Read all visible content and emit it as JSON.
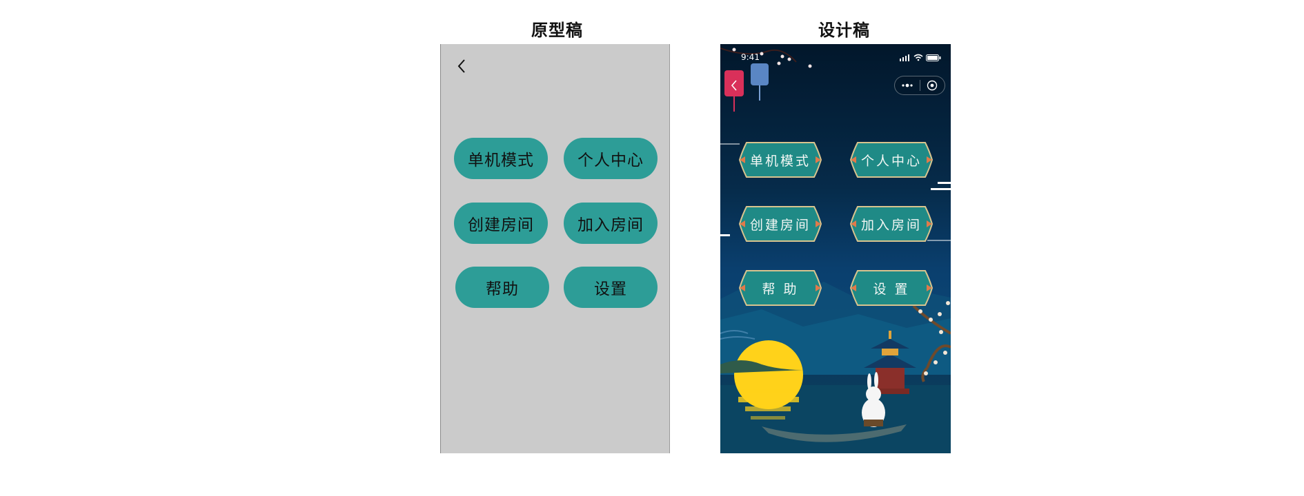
{
  "headings": {
    "prototype": "原型稿",
    "design": "设计稿"
  },
  "menu": [
    {
      "id": "single",
      "label": "单机模式",
      "design_label": "单机模式"
    },
    {
      "id": "profile",
      "label": "个人中心",
      "design_label": "个人中心"
    },
    {
      "id": "create",
      "label": "创建房间",
      "design_label": "创建房间"
    },
    {
      "id": "join",
      "label": "加入房间",
      "design_label": "加入房间"
    },
    {
      "id": "help",
      "label": "帮助",
      "design_label": "帮 助"
    },
    {
      "id": "settings",
      "label": "设置",
      "design_label": "设 置"
    }
  ],
  "statusbar": {
    "time": "9:41"
  },
  "colors": {
    "prototype_bg": "#cbcbcb",
    "prototype_button": "#2d9d97",
    "design_button": "#1f8a86",
    "design_button_border": "#d9c48e",
    "moon": "#ffd21a",
    "lantern_red": "#d9305a",
    "lantern_blue": "#5a86c4"
  },
  "icons": [
    "back-icon",
    "signal-icon",
    "wifi-icon",
    "battery-icon",
    "more-dots-icon",
    "close-circle-icon"
  ]
}
